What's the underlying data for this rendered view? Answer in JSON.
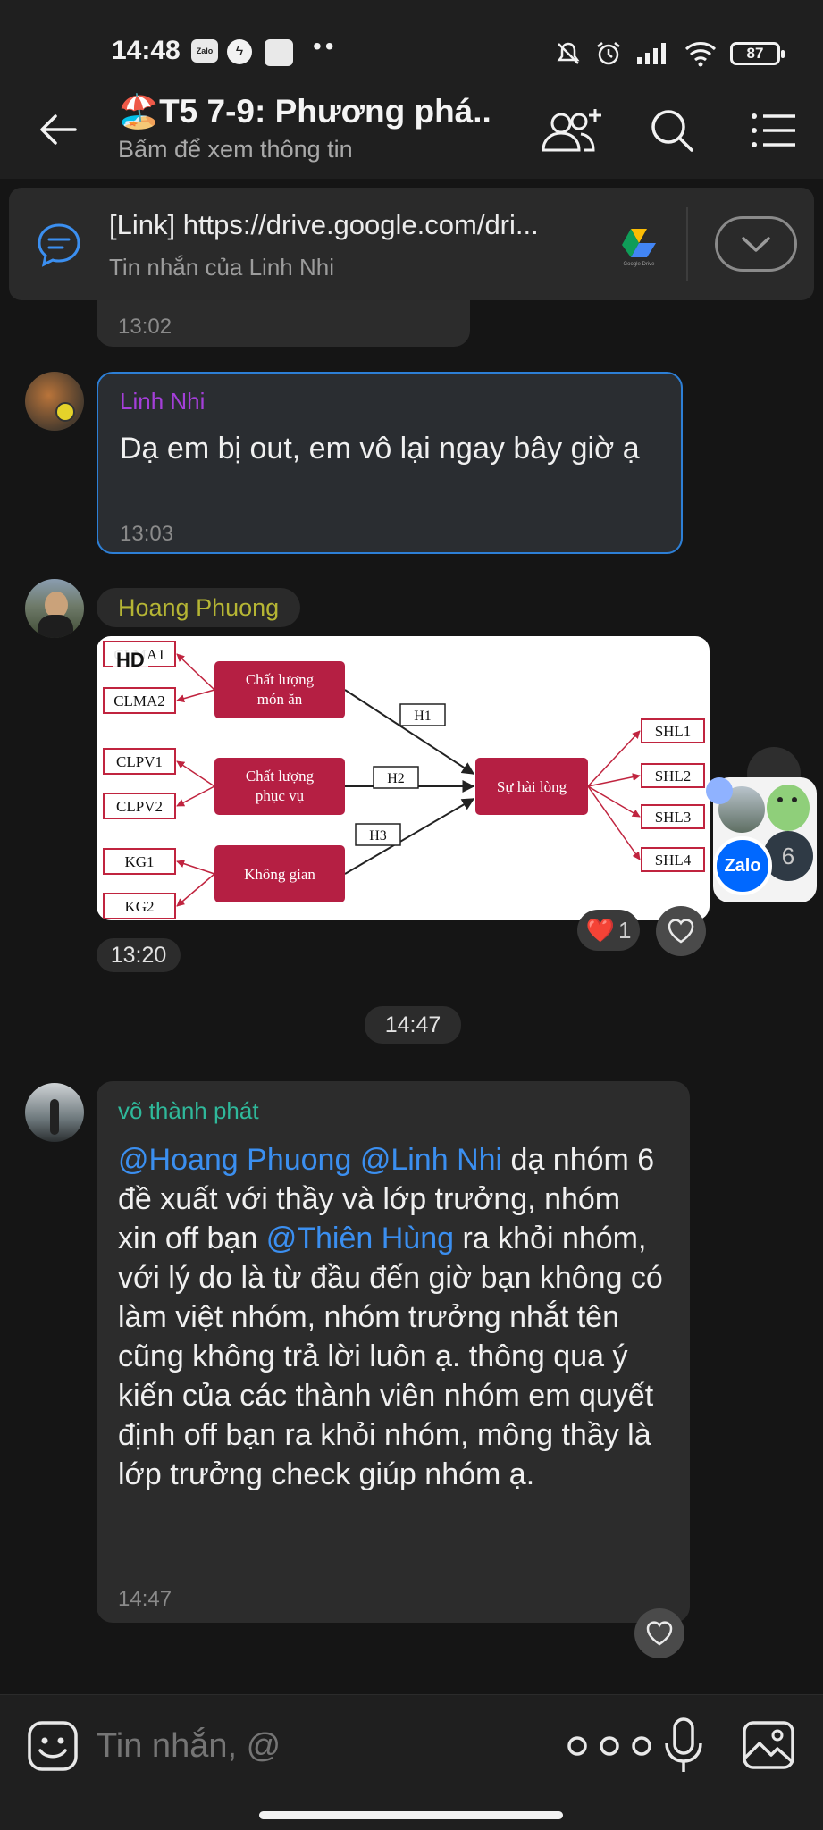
{
  "status_bar": {
    "time": "14:48",
    "app_icons": [
      "zalo-icon",
      "messenger-icon",
      "app-icon"
    ],
    "zalo_label": "Zalo",
    "more_dots": "••",
    "right_icons": [
      "mute-icon",
      "alarm-icon",
      "signal-icon",
      "wifi-icon"
    ],
    "battery": "87"
  },
  "header": {
    "emoji": "🏖️",
    "title": "T5 7-9: Phương phá...",
    "subtitle": "Bấm để xem thông tin"
  },
  "pinned": {
    "title": "[Link] https://drive.google.com/dri...",
    "subtitle": "Tin nhắn của Linh Nhi",
    "drive_label": "Google Drive"
  },
  "messages": [
    {
      "time": "13:02"
    },
    {
      "sender": "Linh Nhi",
      "sender_color": "#a43fd9",
      "text": "Dạ em bị out, em vô lại ngay bây giờ ạ",
      "time": "13:03"
    },
    {
      "sender": "Hoang Phuong",
      "sender_color": "#b5b534",
      "image_badge": "HD",
      "time": "13:20",
      "reaction_emoji": "❤️",
      "reaction_count": "1"
    },
    {
      "sender": "võ thành phát",
      "sender_color": "#2fb89a",
      "mention1": "@Hoang Phuong",
      "mention2": "@Linh Nhi",
      "text1": " dạ nhóm 6 đề xuất với thầy và lớp trưởng, nhóm xin off bạn ",
      "mention3": "@Thiên Hùng",
      "text2": " ra khỏi nhóm, với lý do là từ đầu đến giờ bạn không có làm việt nhóm, nhóm trưởng nhắt tên cũng không trả lời luôn ạ. thông qua ý kiến của các thành viên nhóm em quyết định off bạn ra khỏi nhóm, mông thầy là lớp trưởng check giúp nhóm ạ.",
      "time": "14:47"
    }
  ],
  "date_separator": "14:47",
  "diagram": {
    "left_boxes": [
      "CLMA1",
      "CLMA2",
      "CLPV1",
      "CLPV2",
      "KG1",
      "KG2"
    ],
    "constructs": [
      "Chất lượng món ăn",
      "Chất lượng phục vụ",
      "Không gian"
    ],
    "construct_lines": [
      [
        "Chất lượng",
        "món ăn"
      ],
      [
        "Chất lượng",
        "phục vụ"
      ],
      [
        "Không gian"
      ]
    ],
    "hypotheses": [
      "H1",
      "H2",
      "H3"
    ],
    "outcome": "Sự hài lòng",
    "right_boxes": [
      "SHL1",
      "SHL2",
      "SHL3",
      "SHL4"
    ],
    "colors": {
      "construct": "#b51f43",
      "box_border": "#c0243f"
    }
  },
  "float_bubble": {
    "label": "Zalo",
    "count": "6"
  },
  "composer": {
    "placeholder": "Tin nhắn, @"
  }
}
